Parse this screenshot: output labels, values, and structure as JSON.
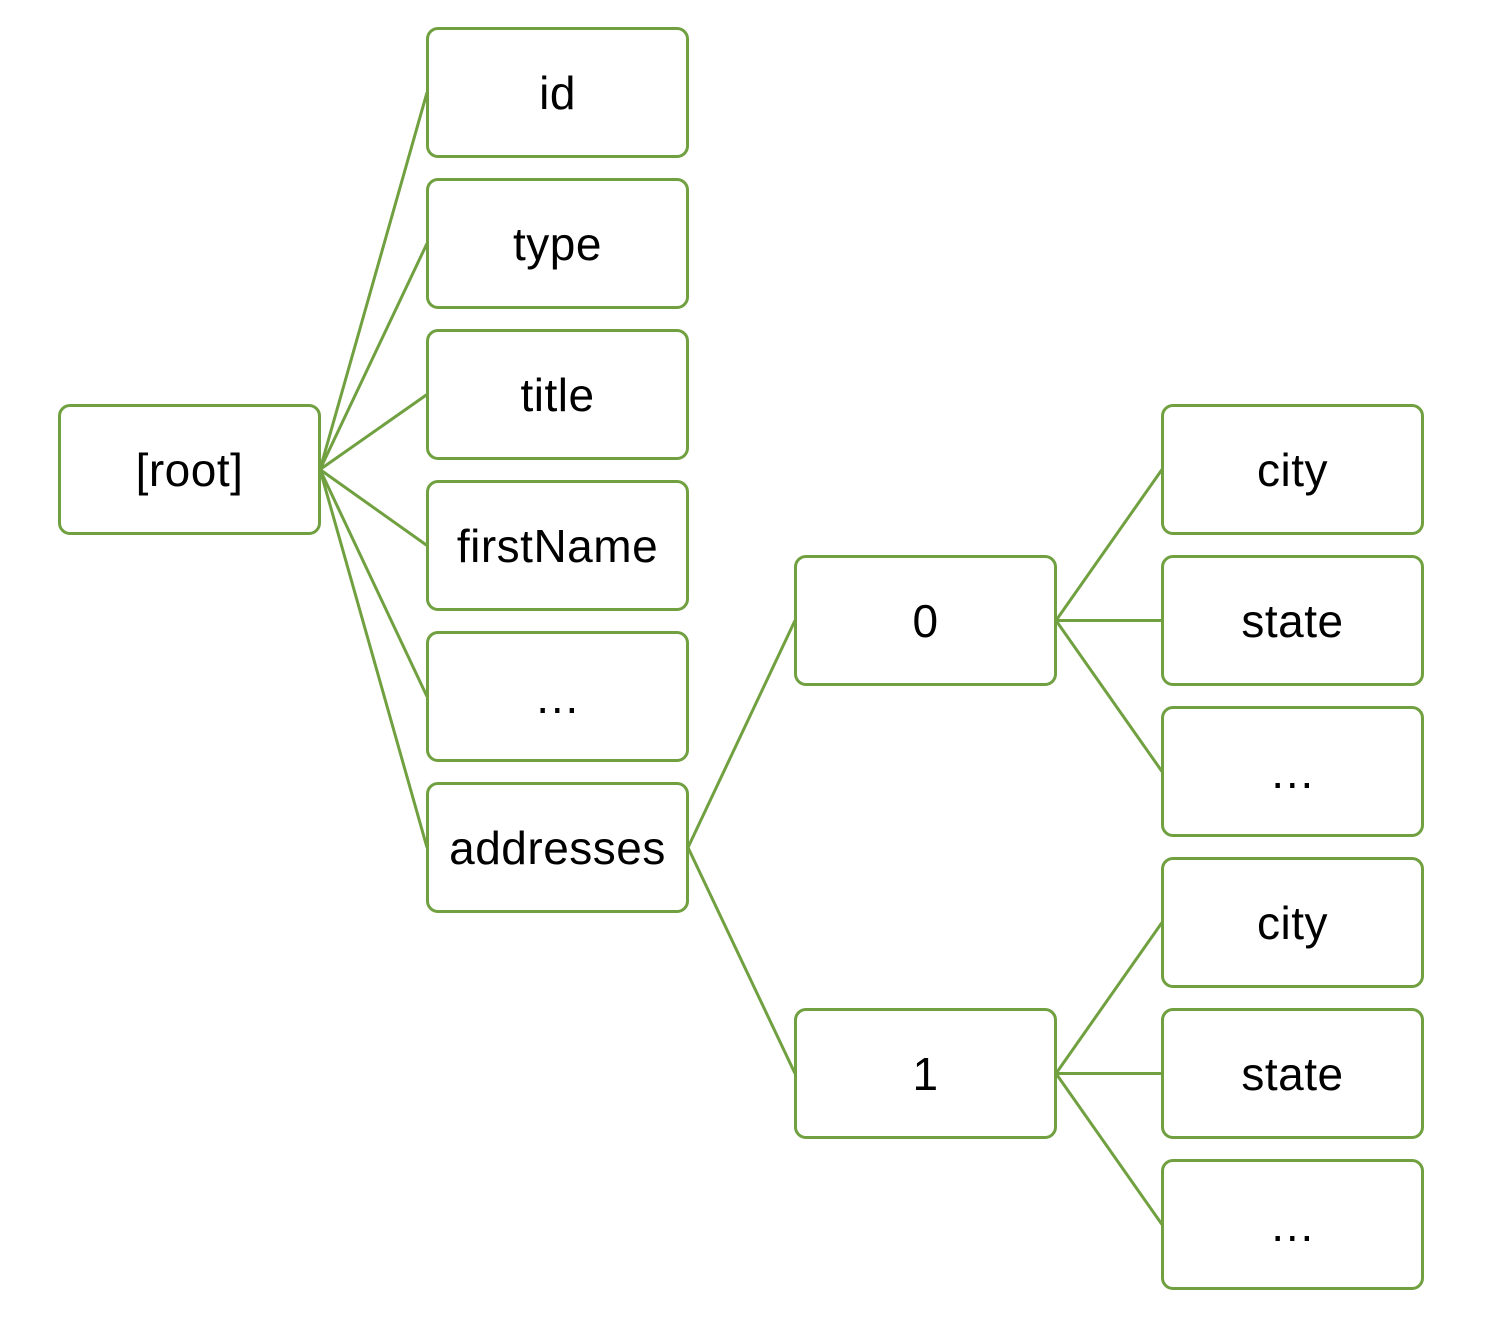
{
  "diagram": {
    "type": "tree",
    "colors": {
      "stroke": "#70a040",
      "fill": "#ffffff",
      "text": "#000000"
    },
    "nodes": [
      {
        "id": "root",
        "label": "[root]",
        "parent": null
      },
      {
        "id": "id",
        "label": "id",
        "parent": "root"
      },
      {
        "id": "type",
        "label": "type",
        "parent": "root"
      },
      {
        "id": "title",
        "label": "title",
        "parent": "root"
      },
      {
        "id": "firstName",
        "label": "firstName",
        "parent": "root"
      },
      {
        "id": "root-more",
        "label": "…",
        "parent": "root"
      },
      {
        "id": "addresses",
        "label": "addresses",
        "parent": "root"
      },
      {
        "id": "addr0",
        "label": "0",
        "parent": "addresses"
      },
      {
        "id": "addr1",
        "label": "1",
        "parent": "addresses"
      },
      {
        "id": "addr0-city",
        "label": "city",
        "parent": "addr0"
      },
      {
        "id": "addr0-state",
        "label": "state",
        "parent": "addr0"
      },
      {
        "id": "addr0-more",
        "label": "…",
        "parent": "addr0"
      },
      {
        "id": "addr1-city",
        "label": "city",
        "parent": "addr1"
      },
      {
        "id": "addr1-state",
        "label": "state",
        "parent": "addr1"
      },
      {
        "id": "addr1-more",
        "label": "…",
        "parent": "addr1"
      }
    ]
  }
}
